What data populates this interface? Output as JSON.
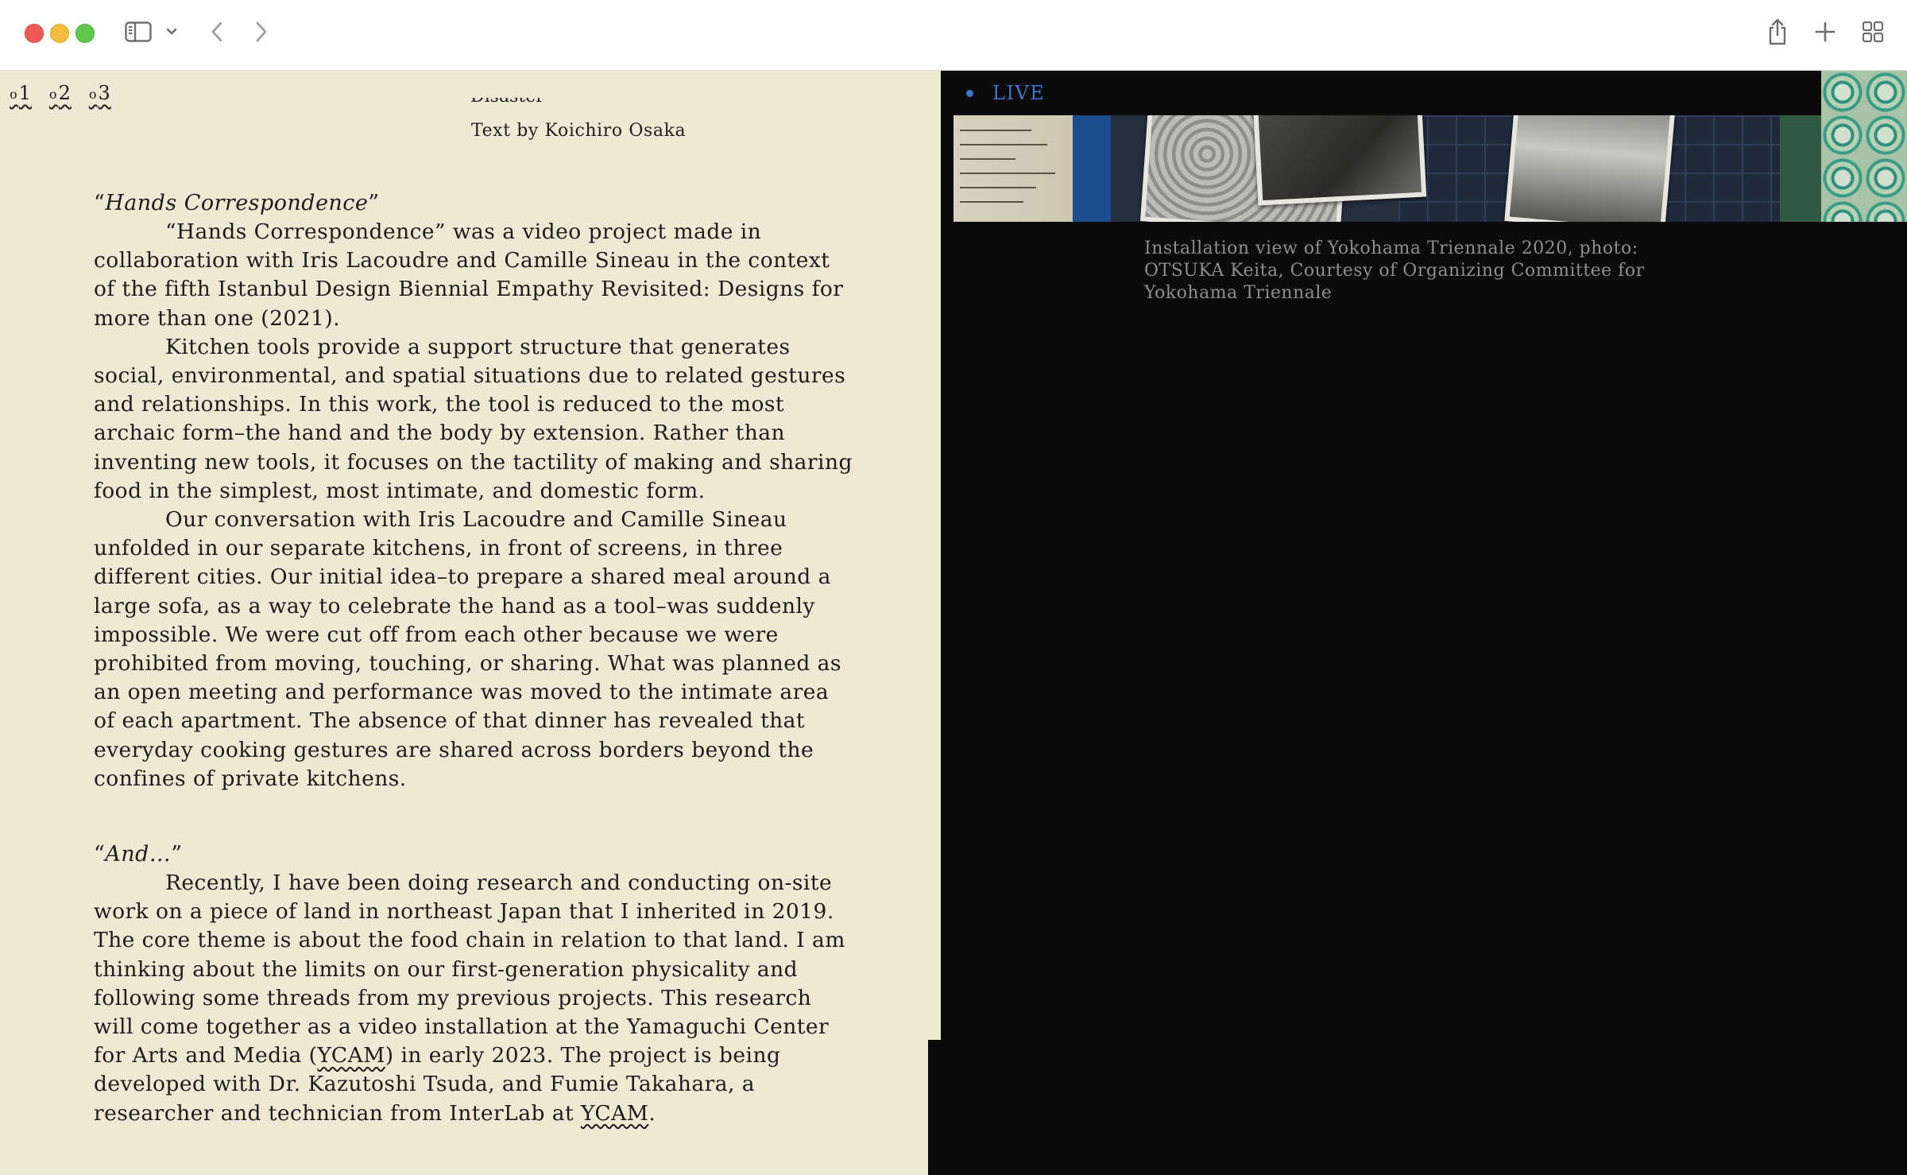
{
  "browser": {
    "icons": [
      "sidebar-icon",
      "chevron-down-icon",
      "back-icon",
      "forward-icon",
      "share-icon",
      "new-tab-icon",
      "tab-overview-icon"
    ]
  },
  "footnotes": [
    {
      "label": "1"
    },
    {
      "label": "2"
    },
    {
      "label": "3"
    }
  ],
  "article": {
    "cut_line": "Disaster",
    "byline": "Text by Koichiro Osaka",
    "section1": {
      "title": "Hands Correspondence",
      "paragraphs": [
        "“Hands Correspondence” was a video project made in collaboration with Iris Lacoudre and Camille Sineau in the context of the fifth Istanbul Design Biennial Empathy Revisited: Designs for more than one (2021).",
        "Kitchen tools provide a support structure that generates social, environmental, and spatial situations due to related gestures and relationships. In this work, the tool is reduced to the most archaic form–the hand and the body by extension. Rather than inventing new tools, it focuses on the tactility of making and sharing food in the simplest, most intimate, and domestic form.",
        "Our conversation with Iris Lacoudre and Camille Sineau unfolded in our separate kitchens, in front of screens, in three different cities. Our initial idea–to prepare a shared meal around a large sofa, as a way to celebrate the hand as a tool–was suddenly impossible. We were cut off from each other because we were prohibited from moving, touching, or sharing. What was planned as an open meeting and performance was moved to the intimate area of each apartment. The absence of that dinner has revealed that everyday cooking gestures are shared across borders beyond the confines of private kitchens."
      ]
    },
    "section2": {
      "title": "And…",
      "para_a": "Recently, I have been doing research and conducting on-site work on a piece of land in northeast Japan that I inherited in 2019. The core theme is about the food chain in relation to that land. I am thinking about the limits on our first-generation physicality and following some threads from my previous projects. This research will come together as a video installation at the Yamaguchi Center for Arts and Media (",
      "ycam_1": "YCAM",
      "para_b": ") in early 2023. The project is being developed with Dr. Kazutoshi Tsuda, and Fumie Takahara, a researcher and technician from InterLab at ",
      "ycam_2": "YCAM",
      "para_c": "."
    }
  },
  "live": {
    "label": "LIVE",
    "accent_color": "#3f74c6",
    "caption": "Installation view of Yokohama Triennale 2020, photo: OTSUKA Keita, Courtesy of Organizing Committee for Yokohama Triennale"
  }
}
